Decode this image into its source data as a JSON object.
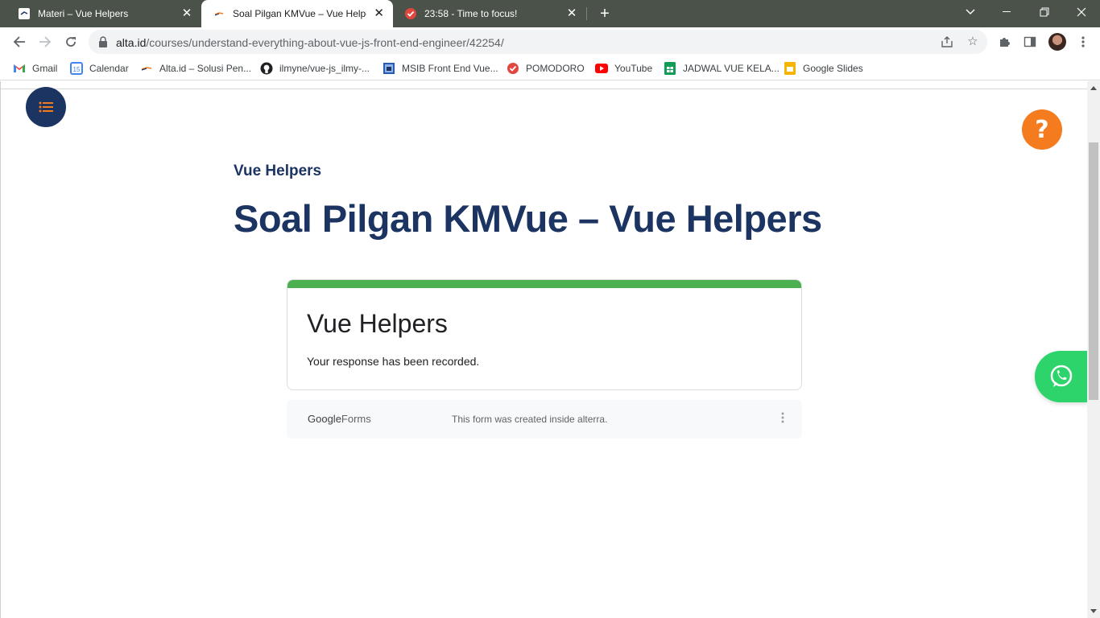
{
  "browser": {
    "tabs": [
      {
        "title": "Materi – Vue Helpers",
        "icon": "alta-favicon",
        "active": false
      },
      {
        "title": "Soal Pilgan KMVue – Vue Helpers",
        "icon": "alta-favicon",
        "active": true
      },
      {
        "title": "23:58 - Time to focus!",
        "icon": "pomodoro-check-icon",
        "active": false
      }
    ],
    "url": {
      "host": "alta.id",
      "path": "/courses/understand-everything-about-vue-js-front-end-engineer/42254/"
    },
    "bookmarks": [
      {
        "label": "Gmail",
        "icon": "gmail-icon"
      },
      {
        "label": "Calendar",
        "icon": "calendar-icon"
      },
      {
        "label": "Alta.id – Solusi Pen...",
        "icon": "alta-icon"
      },
      {
        "label": "ilmyne/vue-js_ilmy-...",
        "icon": "github-icon"
      },
      {
        "label": "MSIB Front End Vue...",
        "icon": "msib-icon"
      },
      {
        "label": "POMODORO",
        "icon": "pomodoro-icon"
      },
      {
        "label": "YouTube",
        "icon": "youtube-icon"
      },
      {
        "label": "JADWAL VUE KELA...",
        "icon": "sheets-icon"
      },
      {
        "label": "Google Slides",
        "icon": "slides-icon"
      }
    ],
    "calendar_day": "15"
  },
  "page": {
    "breadcrumb": "Vue Helpers",
    "title": "Soal Pilgan KMVue – Vue Helpers",
    "form": {
      "title": "Vue Helpers",
      "message": "Your response has been recorded."
    },
    "footer": {
      "logo_google": "Google",
      "logo_forms": "Forms",
      "note": "This form was created inside alterra."
    },
    "help_label": "?"
  },
  "colors": {
    "navy": "#1c3461",
    "orange": "#f47c1f",
    "whatsapp_green": "#2cd46b",
    "form_accent": "#4caf50",
    "tabstrip": "#4a5249"
  }
}
